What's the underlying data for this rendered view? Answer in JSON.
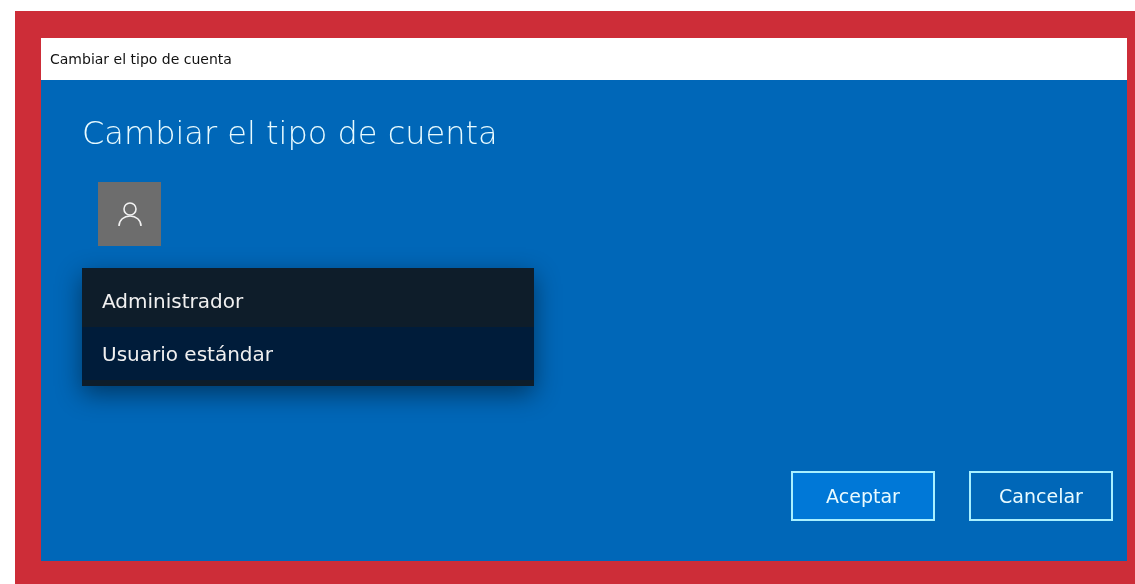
{
  "window": {
    "title": "Cambiar el tipo de cuenta"
  },
  "heading": "Cambiar el tipo de cuenta",
  "account_type_menu": [
    {
      "label": "Administrador",
      "selected": false
    },
    {
      "label": "Usuario estándar",
      "selected": true
    }
  ],
  "buttons": [
    {
      "label": "Aceptar",
      "default": true
    },
    {
      "label": "Cancelar",
      "default": false
    }
  ]
}
